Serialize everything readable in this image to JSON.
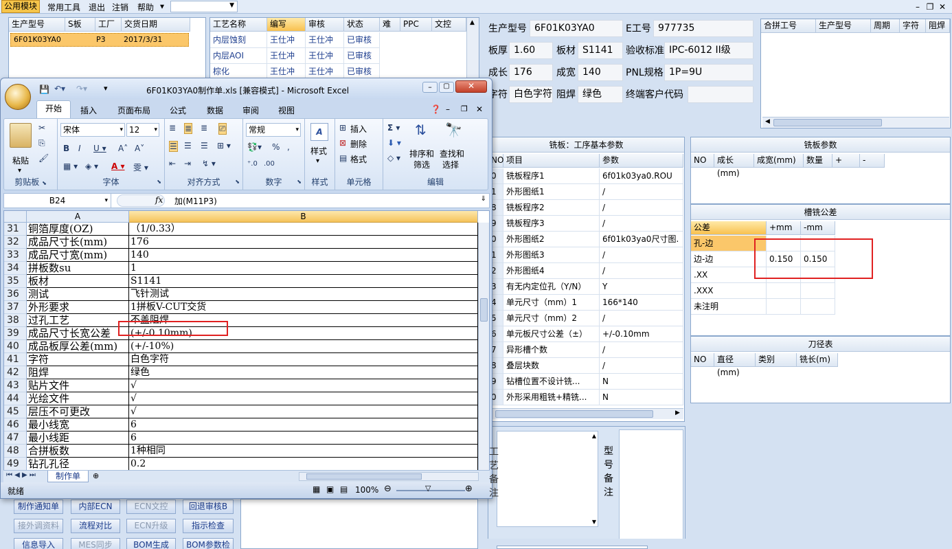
{
  "menubar": {
    "items": [
      "公用模块",
      "常用工具",
      "退出",
      "注销",
      "帮助"
    ],
    "help_arrow": "▾"
  },
  "top_left_grid": {
    "headers": [
      "生产型号",
      "S板",
      "工厂",
      "交货日期"
    ],
    "row": [
      "6F01K03YA0",
      "P3",
      "2017/3/31"
    ]
  },
  "process_grid": {
    "headers": [
      "工艺名称",
      "编写",
      "审核",
      "状态",
      "难",
      "PPC",
      "文控"
    ],
    "rows": [
      [
        "内层蚀刻",
        "王仕冲",
        "王仕冲",
        "已审核"
      ],
      [
        "内层AOI",
        "王仕冲",
        "王仕冲",
        "已审核"
      ],
      [
        "棕化",
        "王仕冲",
        "王仕冲",
        "已审核"
      ]
    ]
  },
  "info": {
    "prod_model_label": "生产型号",
    "prod_model": "6F01K03YA0",
    "e_no_label": "E工号",
    "e_no": "977735",
    "thickness_label": "板厚",
    "thickness": "1.60",
    "material_label": "板材",
    "material": "S1141",
    "standard_label": "验收标准",
    "standard": "IPC-6012 II级",
    "length_label": "成长",
    "length": "176",
    "width_label": "成宽",
    "width": "140",
    "pnl_label": "PNL规格",
    "pnl": "1P=9U",
    "char_label": "字符",
    "char": "白色字符",
    "mask_label": "阻焊",
    "mask": "绿色",
    "customer_label": "终端客户代码",
    "customer": ""
  },
  "combine_grid": {
    "headers": [
      "合拼工号",
      "生产型号",
      "周期",
      "字符",
      "阻焊"
    ]
  },
  "milling_process": {
    "title": "铣板：工序基本参数",
    "headers": [
      "NO",
      "项目",
      "参数"
    ],
    "rows": [
      [
        "0",
        "铣板程序1",
        "6f01k03ya0.ROU"
      ],
      [
        "1",
        "外形图纸1",
        "/"
      ],
      [
        "8",
        "铣板程序2",
        "/"
      ],
      [
        "9",
        "铣板程序3",
        "/"
      ],
      [
        "0",
        "外形图纸2",
        "6f01k03ya0尺寸图."
      ],
      [
        "1",
        "外形图纸3",
        "/"
      ],
      [
        "2",
        "外形图纸4",
        "/"
      ],
      [
        "3",
        "有无内定位孔（Y/N）",
        "Y"
      ],
      [
        "4",
        "单元尺寸（mm）1",
        "166*140"
      ],
      [
        "5",
        "单元尺寸（mm）2",
        "/"
      ],
      [
        "6",
        "单元板尺寸公差（±）",
        "+/-0.10mm"
      ],
      [
        "7",
        "异形槽个数",
        "/"
      ],
      [
        "8",
        "叠层块数",
        "/"
      ],
      [
        "9",
        "钻槽位置不设计铣...",
        "N"
      ],
      [
        "0",
        "外形采用粗铣+精铣...",
        "N"
      ]
    ]
  },
  "milling_params": {
    "title": "铣板参数",
    "headers": [
      "NO",
      "成长(mm)",
      "成宽(mm)",
      "数量",
      "+",
      "-"
    ]
  },
  "slot_tolerance": {
    "title": "槽铣公差",
    "headers": [
      "公差",
      "+mm",
      "-mm"
    ],
    "rows": [
      [
        "孔-边",
        "",
        ""
      ],
      [
        "边-边",
        "0.150",
        "0.150"
      ],
      [
        ".XX",
        "",
        ""
      ],
      [
        ".XXX",
        "",
        ""
      ],
      [
        "未注明",
        "",
        ""
      ]
    ]
  },
  "tool_table": {
    "title": "刀径表",
    "headers": [
      "NO",
      "直径(mm)",
      "类别",
      "铣长(m)"
    ]
  },
  "remarks": {
    "process_note_label": "工艺备注",
    "model_note_label": "型号备注"
  },
  "bottom_buttons": [
    [
      "制作通知单",
      "内部ECN",
      "ECN文控",
      "回退审核B"
    ],
    [
      "接外调资料",
      "流程对比",
      "ECN升级",
      "指示检查"
    ],
    [
      "信息导入",
      "MES同步",
      "BOM生成",
      "BOM参数检查"
    ]
  ],
  "excel": {
    "title": "6F01K03YA0制作单.xls  [兼容模式] - Microsoft Excel",
    "tabs": [
      "开始",
      "插入",
      "页面布局",
      "公式",
      "数据",
      "审阅",
      "视图"
    ],
    "font_name": "宋体",
    "font_size": "12",
    "number_format": "常规",
    "groups": [
      "剪贴板",
      "字体",
      "对齐方式",
      "数字",
      "样式",
      "单元格",
      "编辑"
    ],
    "paste": "粘贴",
    "style": "样式",
    "insert": "插入",
    "delete": "删除",
    "format": "格式",
    "sort": "排序和",
    "sort2": "筛选",
    "find": "查找和",
    "find2": "选择",
    "cell_ref": "B24",
    "fx": "fx",
    "formula": "加(M11P3)",
    "col_a": "A",
    "col_b": "B",
    "rows": [
      [
        "31",
        "铜箔厚度(OZ)",
        "（1/0.33）"
      ],
      [
        "32",
        "成品尺寸长(mm)",
        "176"
      ],
      [
        "33",
        "成品尺寸宽(mm)",
        "140"
      ],
      [
        "34",
        "拼板数su",
        "1"
      ],
      [
        "35",
        "板材",
        "S1141"
      ],
      [
        "36",
        "测试",
        "飞针测试"
      ],
      [
        "37",
        "外形要求",
        "1拼板V-CUT交货"
      ],
      [
        "38",
        "过孔工艺",
        "不盖阻焊"
      ],
      [
        "39",
        "成品尺寸长宽公差",
        "(+/-0.10mm)"
      ],
      [
        "40",
        "成品板厚公差(mm)",
        "(+/-10%)"
      ],
      [
        "41",
        "字符",
        "白色字符"
      ],
      [
        "42",
        "阻焊",
        "绿色"
      ],
      [
        "43",
        "贴片文件",
        "√"
      ],
      [
        "44",
        "光绘文件",
        "√"
      ],
      [
        "45",
        "层压不可更改",
        "√"
      ],
      [
        "46",
        "最小线宽",
        "6"
      ],
      [
        "47",
        "最小线距",
        "6"
      ],
      [
        "48",
        "合拼板数",
        "1种相同"
      ],
      [
        "49",
        "钻孔孔径",
        "0.2"
      ]
    ],
    "sheet_tab": "制作单",
    "status": "就绪",
    "zoom": "100%"
  }
}
